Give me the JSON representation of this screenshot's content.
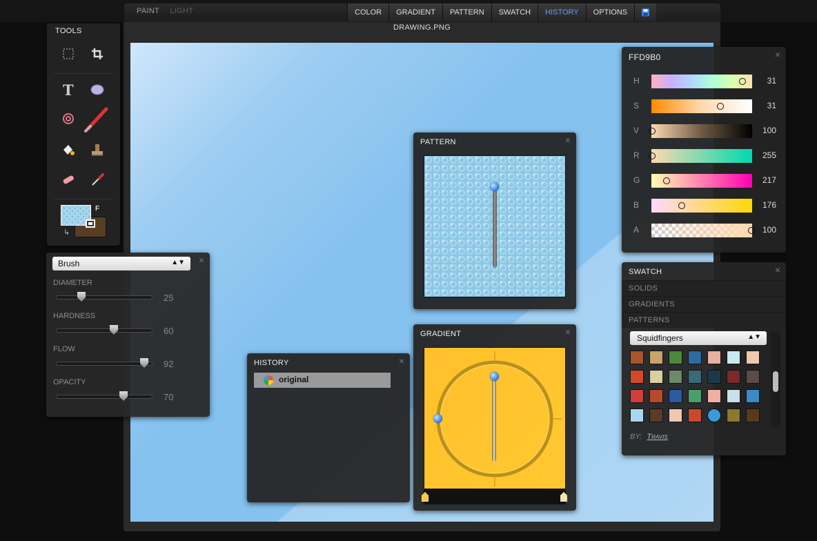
{
  "topnav": {
    "paint": "PAINT",
    "light": "LIGHT"
  },
  "menu": [
    "COLOR",
    "GRADIENT",
    "PATTERN",
    "SWATCH",
    "HISTORY",
    "OPTIONS"
  ],
  "menu_active": "HISTORY",
  "document": {
    "title": "DRAWING.PNG"
  },
  "tools": {
    "title": "TOOLS",
    "fill_label": "F"
  },
  "brush": {
    "selected": "Brush",
    "diameter_label": "DIAMETER",
    "diameter": "25",
    "diameter_level": 0.25,
    "hardness_label": "HARDNESS",
    "hardness": "60",
    "hardness_level": 0.6,
    "flow_label": "FLOW",
    "flow": "92",
    "flow_level": 0.92,
    "opacity_label": "OPACITY",
    "opacity": "70",
    "opacity_level": 0.7
  },
  "pattern": {
    "title": "PATTERN"
  },
  "gradient": {
    "title": "GRADIENT"
  },
  "history": {
    "title": "HISTORY",
    "items": [
      "original"
    ]
  },
  "color": {
    "hex": "FFD9B0",
    "rows": [
      {
        "label": "H",
        "value": "31"
      },
      {
        "label": "S",
        "value": "31"
      },
      {
        "label": "V",
        "value": "100"
      },
      {
        "label": "R",
        "value": "255"
      },
      {
        "label": "G",
        "value": "217"
      },
      {
        "label": "B",
        "value": "176"
      },
      {
        "label": "A",
        "value": "100"
      }
    ]
  },
  "swatch": {
    "title": "SWATCH",
    "tabs": [
      "SOLIDS",
      "GRADIENTS",
      "PATTERNS"
    ],
    "selected_set": "Squidfingers",
    "by_label": "BY:",
    "author": "Travis"
  },
  "close": "×"
}
